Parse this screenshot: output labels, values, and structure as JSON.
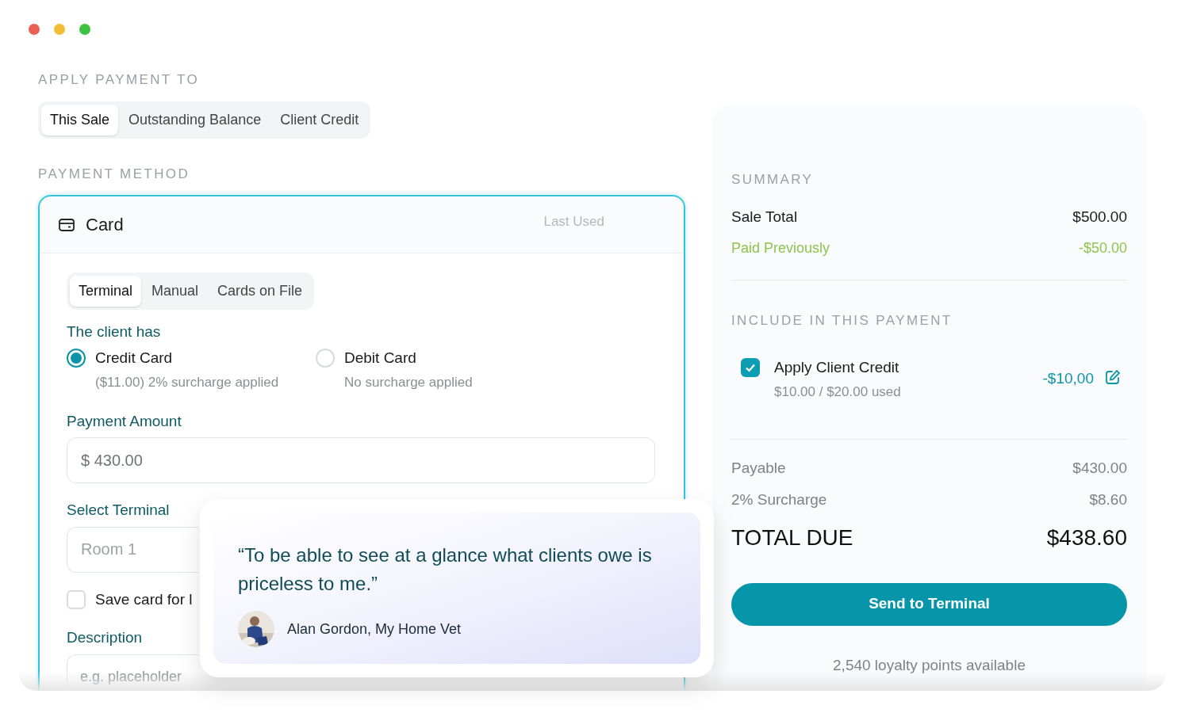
{
  "apply_payment_to": {
    "label": "APPLY PAYMENT TO",
    "tabs": [
      {
        "label": "This Sale",
        "selected": true
      },
      {
        "label": "Outstanding Balance",
        "selected": false
      },
      {
        "label": "Client Credit",
        "selected": false
      }
    ]
  },
  "payment_method": {
    "label": "PAYMENT METHOD",
    "card": {
      "title": "Card",
      "last_used": "Last Used",
      "tabs": [
        {
          "label": "Terminal",
          "selected": true
        },
        {
          "label": "Manual",
          "selected": false
        },
        {
          "label": "Cards on File",
          "selected": false
        }
      ],
      "client_has_label": "The client has",
      "options": [
        {
          "label": "Credit Card",
          "note": "($11.00) 2% surcharge applied",
          "selected": true
        },
        {
          "label": "Debit Card",
          "note": "No surcharge applied",
          "selected": false
        }
      ],
      "payment_amount": {
        "label": "Payment Amount",
        "value": "$ 430.00"
      },
      "select_terminal": {
        "label": "Select Terminal",
        "placeholder": "Room 1"
      },
      "save_card": {
        "label": "Save card for l",
        "checked": false
      },
      "description": {
        "label": "Description",
        "placeholder": "e.g. placeholder"
      }
    }
  },
  "summary": {
    "label": "SUMMARY",
    "rows": [
      {
        "label": "Sale Total",
        "value": "$500.00",
        "kind": "normal"
      },
      {
        "label": "Paid Previously",
        "value": "-$50.00",
        "kind": "paid"
      }
    ],
    "include_label": "INCLUDE IN THIS PAYMENT",
    "credit": {
      "label": "Apply Client Credit",
      "detail": "$10.00 / $20.00 used",
      "amount": "-$10,00",
      "checked": true
    },
    "totals": [
      {
        "label": "Payable",
        "value": "$430.00",
        "kind": "muted"
      },
      {
        "label": "2% Surcharge",
        "value": "$8.60",
        "kind": "muted"
      },
      {
        "label": "TOTAL DUE",
        "value": "$438.60",
        "kind": "total"
      }
    ],
    "button": "Send to Terminal",
    "loyalty": "2,540 loyalty points available"
  },
  "testimonial": {
    "quote": "“To be able to see at a glance what clients owe is priceless to me.”",
    "author": "Alan Gordon, My Home Vet"
  }
}
